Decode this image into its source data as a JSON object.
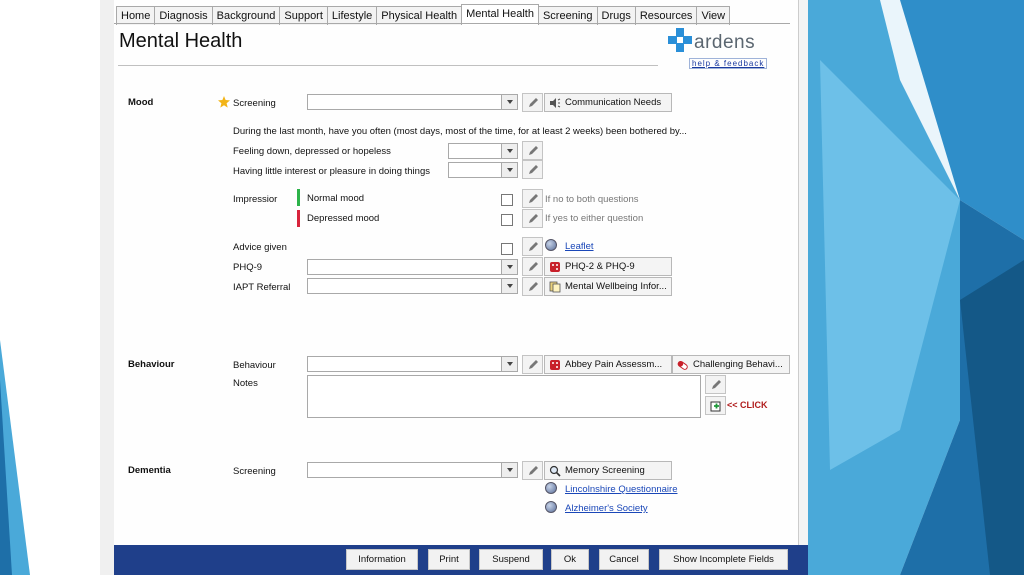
{
  "tabs": [
    "Home",
    "Diagnosis",
    "Background",
    "Support",
    "Lifestyle",
    "Physical Health",
    "Mental Health",
    "Screening",
    "Drugs",
    "Resources",
    "View"
  ],
  "active_tab_index": 6,
  "page_title": "Mental Health",
  "logo_text": "ardens",
  "help_link": "help & feedback",
  "mood": {
    "section": "Mood",
    "screening_label": "Screening",
    "comm_needs_button": "Communication Needs",
    "question": "During the last month, have you often (most days, most of the time, for at least 2 weeks) been bothered by...",
    "q1_label": "Feeling down, depressed or hopeless",
    "q2_label": "Having little interest or pleasure in doing things",
    "impression_label": "Impressior",
    "normal_mood": "Normal mood",
    "depressed_mood": "Depressed mood",
    "hint_no": "If no to both questions",
    "hint_yes": "If yes to either question",
    "advice_label": "Advice given",
    "leaflet_link": "Leaflet",
    "phq_label": "PHQ-9",
    "phq_button": "PHQ-2 & PHQ-9",
    "iapt_label": "IAPT Referral",
    "iapt_button": "Mental Wellbeing Infor..."
  },
  "behaviour": {
    "section": "Behaviour",
    "behaviour_label": "Behaviour",
    "abbey_button": "Abbey Pain Assessm...",
    "challenging_button": "Challenging Behavi...",
    "notes_label": "Notes",
    "click_text": "<< CLICK"
  },
  "dementia": {
    "section": "Dementia",
    "screening_label": "Screening",
    "memory_button": "Memory Screening",
    "lincs_link": "Lincolnshire Questionnaire",
    "alz_link": "Alzheimer's Society"
  },
  "footer": {
    "information": "Information",
    "print": "Print",
    "suspend": "Suspend",
    "ok": "Ok",
    "cancel": "Cancel",
    "show_incomplete": "Show Incomplete Fields"
  },
  "colors": {
    "footer_bar": "#1f3f8a",
    "normal_mood_bar": "#2db34a",
    "depressed_mood_bar": "#d8243c",
    "brand_cross": "#2a8fd8",
    "link": "#1a47b8",
    "slide_blue_dark": "#1e6fa8",
    "slide_blue_light": "#5fb8e2"
  }
}
